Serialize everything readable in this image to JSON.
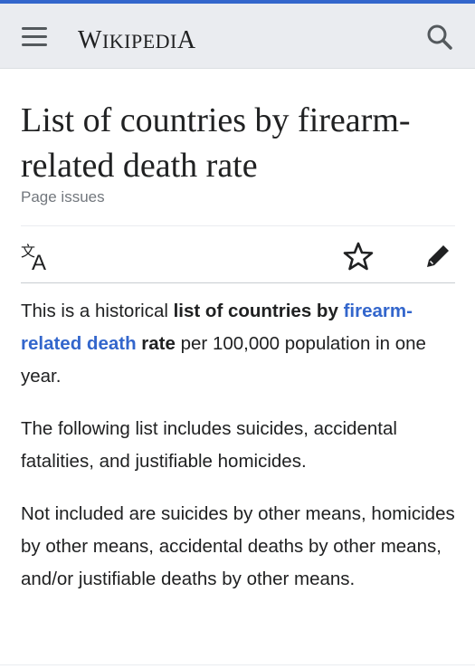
{
  "header": {
    "wordmark": "Wikipedia"
  },
  "page": {
    "title": "List of countries by firearm-related death rate",
    "page_issues_label": "Page issues"
  },
  "article": {
    "p1": {
      "t1": "This is a historical ",
      "b1": "list of countries by ",
      "link": "firearm-related death",
      "b2": " rate",
      "t2": " per 100,000 population in one year."
    },
    "p2": "The following list includes suicides, accidental fatalities, and justifiable homicides.",
    "p3": "Not included are suicides by other means, homicides by other means, accidental deaths by other means, and/or justifiable deaths by other means."
  },
  "colors": {
    "accent": "#36c",
    "link": "#3366cc",
    "header_bg": "#eaecf0",
    "text": "#202122",
    "muted": "#72777d"
  },
  "icons": [
    "menu-icon",
    "search-icon",
    "language-icon",
    "star-icon",
    "edit-pencil-icon"
  ]
}
